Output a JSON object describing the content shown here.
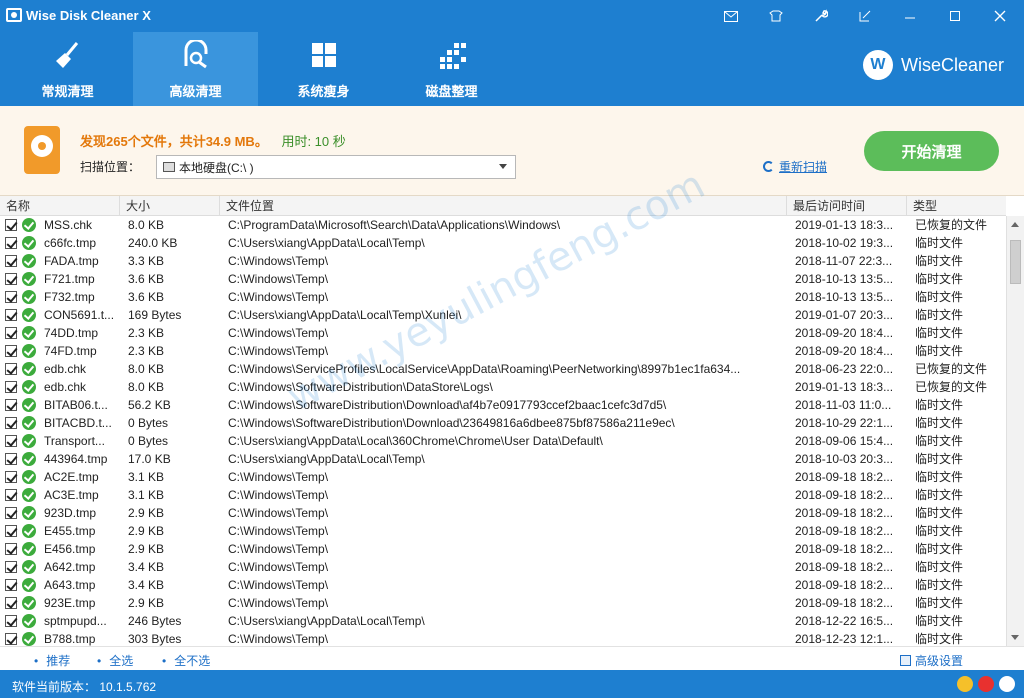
{
  "window": {
    "title": "Wise Disk Cleaner X",
    "controls": [
      "mail-icon",
      "skin-icon",
      "wrench-icon",
      "minimize-icon",
      "restore-icon",
      "maximize-icon",
      "close-icon"
    ]
  },
  "nav": {
    "tabs": [
      {
        "label": "常规清理",
        "icon": "broom-icon",
        "active": false
      },
      {
        "label": "高级清理",
        "icon": "advanced-clean-icon",
        "active": true
      },
      {
        "label": "系统瘦身",
        "icon": "windows-icon",
        "active": false
      },
      {
        "label": "磁盘整理",
        "icon": "defrag-icon",
        "active": false
      }
    ],
    "brand": "WiseCleaner",
    "brand_letter": "W"
  },
  "summary": {
    "found_text": "发现265个文件，共计34.9 MB。",
    "time_text": "用时: 10 秒",
    "scan_location_label": "扫描位置：",
    "drive_value": "本地硬盘(C:\\ )",
    "rescan_label": "重新扫描",
    "start_button": "开始清理"
  },
  "table": {
    "columns": [
      "名称",
      "大小",
      "文件位置",
      "最后访问时间",
      "类型"
    ],
    "rows": [
      {
        "name": "MSS.chk",
        "size": "8.0 KB",
        "path": "C:\\ProgramData\\Microsoft\\Search\\Data\\Applications\\Windows\\",
        "time": "2019-01-13 18:3...",
        "type": "已恢复的文件"
      },
      {
        "name": "c66fc.tmp",
        "size": "240.0 KB",
        "path": "C:\\Users\\xiang\\AppData\\Local\\Temp\\",
        "time": "2018-10-02 19:3...",
        "type": "临时文件"
      },
      {
        "name": "FADA.tmp",
        "size": "3.3 KB",
        "path": "C:\\Windows\\Temp\\",
        "time": "2018-11-07 22:3...",
        "type": "临时文件"
      },
      {
        "name": "F721.tmp",
        "size": "3.6 KB",
        "path": "C:\\Windows\\Temp\\",
        "time": "2018-10-13 13:5...",
        "type": "临时文件"
      },
      {
        "name": "F732.tmp",
        "size": "3.6 KB",
        "path": "C:\\Windows\\Temp\\",
        "time": "2018-10-13 13:5...",
        "type": "临时文件"
      },
      {
        "name": "CON5691.t...",
        "size": "169 Bytes",
        "path": "C:\\Users\\xiang\\AppData\\Local\\Temp\\Xunlei\\",
        "time": "2019-01-07 20:3...",
        "type": "临时文件"
      },
      {
        "name": "74DD.tmp",
        "size": "2.3 KB",
        "path": "C:\\Windows\\Temp\\",
        "time": "2018-09-20 18:4...",
        "type": "临时文件"
      },
      {
        "name": "74FD.tmp",
        "size": "2.3 KB",
        "path": "C:\\Windows\\Temp\\",
        "time": "2018-09-20 18:4...",
        "type": "临时文件"
      },
      {
        "name": "edb.chk",
        "size": "8.0 KB",
        "path": "C:\\Windows\\ServiceProfiles\\LocalService\\AppData\\Roaming\\PeerNetworking\\8997b1ec1fa634...",
        "time": "2018-06-23 22:0...",
        "type": "已恢复的文件"
      },
      {
        "name": "edb.chk",
        "size": "8.0 KB",
        "path": "C:\\Windows\\SoftwareDistribution\\DataStore\\Logs\\",
        "time": "2019-01-13 18:3...",
        "type": "已恢复的文件"
      },
      {
        "name": "BITAB06.t...",
        "size": "56.2 KB",
        "path": "C:\\Windows\\SoftwareDistribution\\Download\\af4b7e0917793ccef2baac1cefc3d7d5\\",
        "time": "2018-11-03 11:0...",
        "type": "临时文件"
      },
      {
        "name": "BITACBD.t...",
        "size": "0 Bytes",
        "path": "C:\\Windows\\SoftwareDistribution\\Download\\23649816a6dbee875bf87586a211e9ec\\",
        "time": "2018-10-29 22:1...",
        "type": "临时文件"
      },
      {
        "name": "Transport...",
        "size": "0 Bytes",
        "path": "C:\\Users\\xiang\\AppData\\Local\\360Chrome\\Chrome\\User Data\\Default\\",
        "time": "2018-09-06 15:4...",
        "type": "临时文件"
      },
      {
        "name": "443964.tmp",
        "size": "17.0 KB",
        "path": "C:\\Users\\xiang\\AppData\\Local\\Temp\\",
        "time": "2018-10-03 20:3...",
        "type": "临时文件"
      },
      {
        "name": "AC2E.tmp",
        "size": "3.1 KB",
        "path": "C:\\Windows\\Temp\\",
        "time": "2018-09-18 18:2...",
        "type": "临时文件"
      },
      {
        "name": "AC3E.tmp",
        "size": "3.1 KB",
        "path": "C:\\Windows\\Temp\\",
        "time": "2018-09-18 18:2...",
        "type": "临时文件"
      },
      {
        "name": "923D.tmp",
        "size": "2.9 KB",
        "path": "C:\\Windows\\Temp\\",
        "time": "2018-09-18 18:2...",
        "type": "临时文件"
      },
      {
        "name": "E455.tmp",
        "size": "2.9 KB",
        "path": "C:\\Windows\\Temp\\",
        "time": "2018-09-18 18:2...",
        "type": "临时文件"
      },
      {
        "name": "E456.tmp",
        "size": "2.9 KB",
        "path": "C:\\Windows\\Temp\\",
        "time": "2018-09-18 18:2...",
        "type": "临时文件"
      },
      {
        "name": "A642.tmp",
        "size": "3.4 KB",
        "path": "C:\\Windows\\Temp\\",
        "time": "2018-09-18 18:2...",
        "type": "临时文件"
      },
      {
        "name": "A643.tmp",
        "size": "3.4 KB",
        "path": "C:\\Windows\\Temp\\",
        "time": "2018-09-18 18:2...",
        "type": "临时文件"
      },
      {
        "name": "923E.tmp",
        "size": "2.9 KB",
        "path": "C:\\Windows\\Temp\\",
        "time": "2018-09-18 18:2...",
        "type": "临时文件"
      },
      {
        "name": "sptmpupd...",
        "size": "246 Bytes",
        "path": "C:\\Users\\xiang\\AppData\\Local\\Temp\\",
        "time": "2018-12-22 16:5...",
        "type": "临时文件"
      },
      {
        "name": "B788.tmp",
        "size": "303 Bytes",
        "path": "C:\\Windows\\Temp\\",
        "time": "2018-12-23 12:1...",
        "type": "临时文件"
      }
    ]
  },
  "bottom": {
    "recommend": "推荐",
    "select_all": "全选",
    "select_none": "全不选",
    "advanced_settings": "高级设置"
  },
  "status": {
    "version": "软件当前版本： 10.1.5.762"
  },
  "watermark": "www.yeyulingfeng.com",
  "colors": {
    "header_blue": "#1e7fd0",
    "active_tab": "#3a95dd",
    "start_green": "#5cbd5a",
    "orange": "#e3780b",
    "link_blue": "#1d6fc7"
  }
}
